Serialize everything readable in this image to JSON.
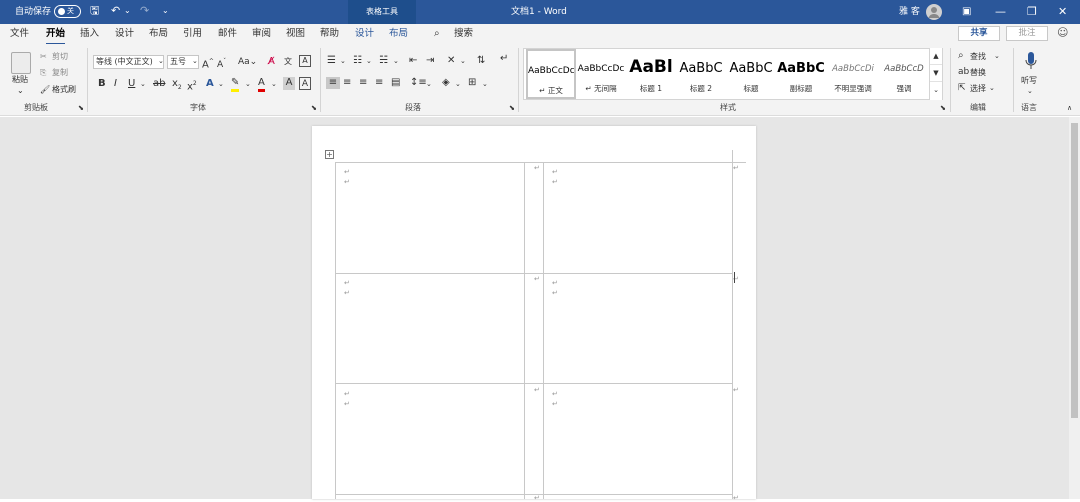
{
  "titlebar": {
    "autosave_label": "自动保存",
    "autosave_state": "关",
    "context_tab": "表格工具",
    "doc_title": "文档1 - Word",
    "user_name": "雅 客",
    "minimize": "—",
    "restore": "❐",
    "close": "✕"
  },
  "tabs": [
    "文件",
    "开始",
    "插入",
    "设计",
    "布局",
    "引用",
    "邮件",
    "审阅",
    "视图",
    "帮助",
    "设计",
    "布局"
  ],
  "search_label": "搜索",
  "share_label": "共享",
  "comment_label": "批注",
  "clipboard": {
    "paste": "粘贴",
    "cut": "剪切",
    "copy": "复制",
    "format_painter": "格式刷",
    "group": "剪贴板"
  },
  "font": {
    "name": "等线 (中文正文)",
    "size": "五号",
    "group": "字体"
  },
  "paragraph": {
    "group": "段落"
  },
  "styles": {
    "group": "样式",
    "items": [
      {
        "sample": "AaBbCcDc",
        "name": "↵ 正文"
      },
      {
        "sample": "AaBbCcDc",
        "name": "↵ 无间隔"
      },
      {
        "sample": "AaBl",
        "name": "标题 1"
      },
      {
        "sample": "AaBbC",
        "name": "标题 2"
      },
      {
        "sample": "AaBbC",
        "name": "标题"
      },
      {
        "sample": "AaBbC",
        "name": "副标题"
      },
      {
        "sample": "AaBbCcDi",
        "name": "不明显强调"
      },
      {
        "sample": "AaBbCcD",
        "name": "强调"
      }
    ]
  },
  "editing": {
    "find": "查找",
    "replace": "替换",
    "select": "选择",
    "group": "编辑"
  },
  "voice": {
    "dictate": "听写",
    "group": "语言"
  },
  "para_mark": "↵",
  "icons": {
    "save": "save-icon",
    "undo": "undo-icon",
    "redo": "redo-icon",
    "customize": "customize-qat-icon",
    "search": "search-icon",
    "avatar": "user-avatar-icon",
    "smiley": "smiley-icon",
    "mic": "microphone-icon",
    "table_move": "table-move-handle-icon"
  },
  "colors": {
    "titlebar": "#2b579a",
    "ribbon": "#f3f3f3",
    "canvas": "#e6e6e6"
  }
}
